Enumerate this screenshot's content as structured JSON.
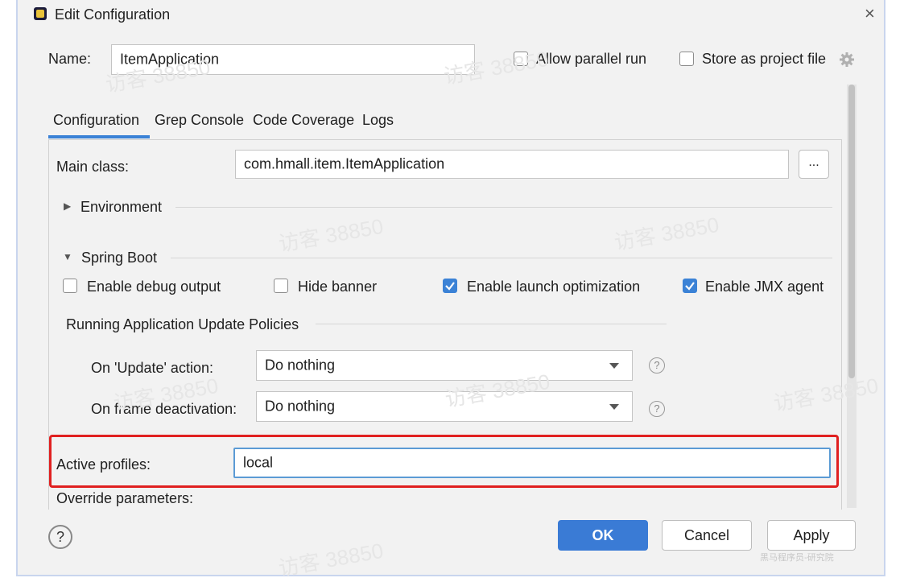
{
  "window": {
    "title": "Edit Configuration",
    "close": "×"
  },
  "name_row": {
    "label": "Name:",
    "value": "ItemApplication",
    "parallel_label": "Allow parallel run",
    "store_label": "Store as project file"
  },
  "tabs": [
    {
      "label": "Configuration",
      "active": true
    },
    {
      "label": "Grep Console",
      "active": false
    },
    {
      "label": "Code Coverage",
      "active": false
    },
    {
      "label": "Logs",
      "active": false
    }
  ],
  "main_class": {
    "label": "Main class:",
    "value": "com.hmall.item.ItemApplication",
    "browse": "..."
  },
  "environment": {
    "label": "Environment"
  },
  "spring_boot": {
    "label": "Spring Boot",
    "options": [
      {
        "label": "Enable debug output",
        "checked": false
      },
      {
        "label": "Hide banner",
        "checked": false
      },
      {
        "label": "Enable launch optimization",
        "checked": true
      },
      {
        "label": "Enable JMX agent",
        "checked": true
      }
    ],
    "policies_title": "Running Application Update Policies",
    "update_action": {
      "label": "On 'Update' action:",
      "value": "Do nothing"
    },
    "frame_deactivation": {
      "label": "On frame deactivation:",
      "value": "Do nothing"
    }
  },
  "active_profiles": {
    "label": "Active profiles:",
    "value": "local"
  },
  "override": {
    "label": "Override parameters:"
  },
  "buttons": {
    "help": "?",
    "ok": "OK",
    "cancel": "Cancel",
    "apply": "Apply"
  },
  "watermarks": [
    "访客 38850",
    "访客 38850",
    "访客 38850",
    "访客 38850",
    "访客 38850",
    "访客 38850",
    "访客 38850",
    "访客 38850"
  ],
  "corner_mark": "黑马程序员-研究院",
  "colors": {
    "accent": "#3b82d6",
    "highlight_box": "#e02020",
    "ok_button": "#3a7bd5"
  }
}
